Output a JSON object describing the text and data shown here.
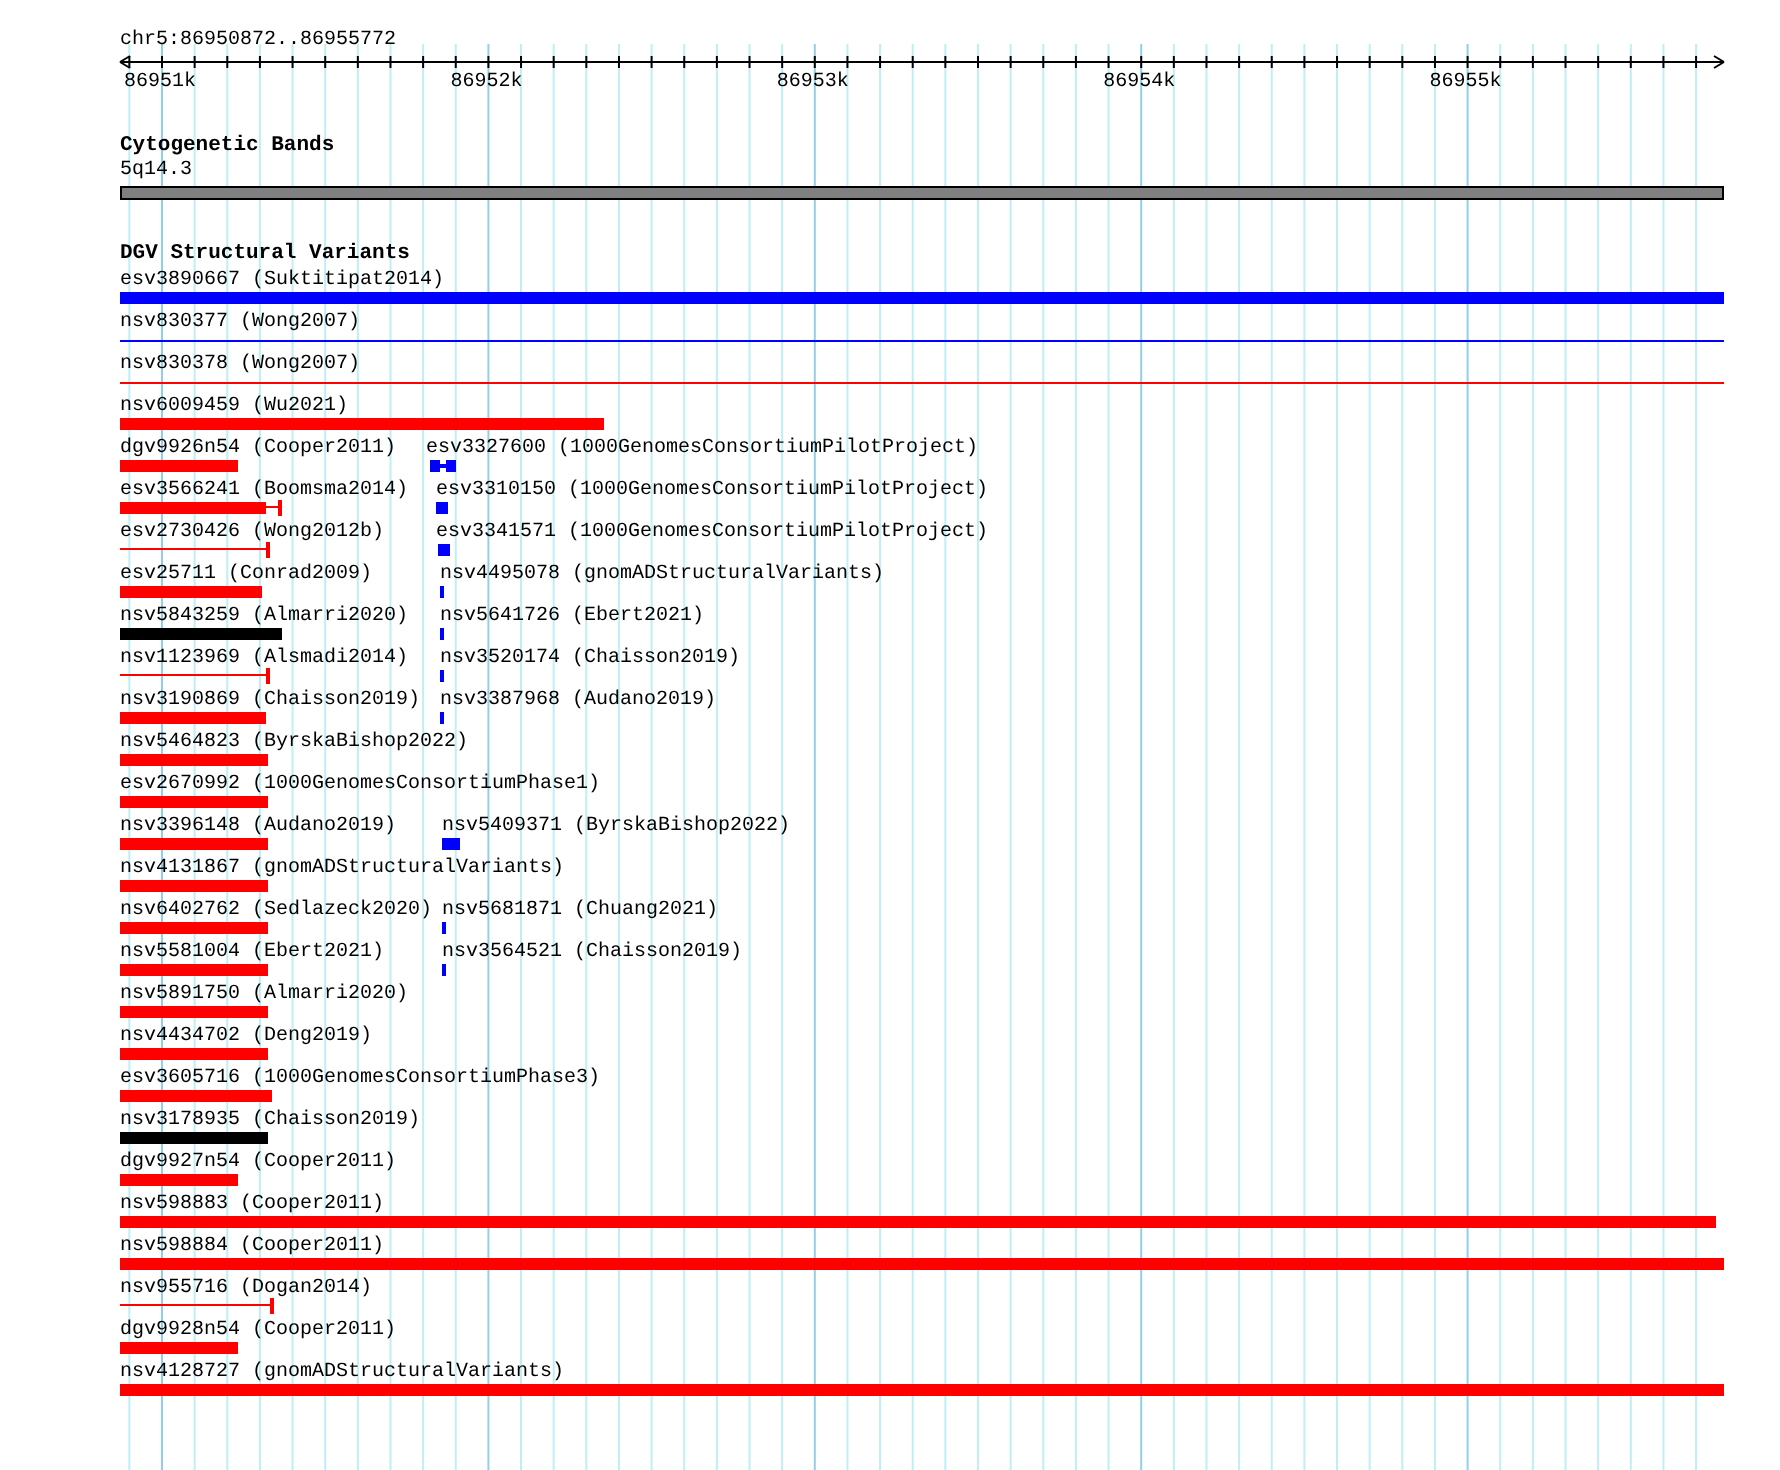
{
  "ruler": {
    "location": "chr5:86950872..86955772",
    "ticks": [
      "86951k",
      "86952k",
      "86953k",
      "86954k",
      "86955k"
    ]
  },
  "cytoband_track": {
    "title": "Cytogenetic Bands",
    "band": "5q14.3"
  },
  "dgv_track": {
    "title": "DGV Structural Variants",
    "rows": [
      {
        "features": [
          {
            "label": "esv3890667 (Suktitipat2014)",
            "color": "#0000ff",
            "kind": "thick"
          }
        ]
      },
      {
        "features": [
          {
            "label": "nsv830377 (Wong2007)",
            "color": "#0000ff",
            "kind": "thin"
          }
        ]
      },
      {
        "features": [
          {
            "label": "nsv830378 (Wong2007)",
            "color": "#ff0000",
            "kind": "thin"
          }
        ]
      },
      {
        "features": [
          {
            "label": "nsv6009459 (Wu2021)",
            "color": "#ff0000",
            "kind": "thick"
          }
        ]
      },
      {
        "features": [
          {
            "label": "dgv9926n54 (Cooper2011)",
            "color": "#ff0000",
            "kind": "thick"
          },
          {
            "label": "esv3327600 (1000GenomesConsortiumPilotProject)",
            "color": "#0000ff",
            "kind": "blocks"
          }
        ]
      },
      {
        "features": [
          {
            "label": "esv3566241 (Boomsma2014)",
            "color": "#ff0000",
            "kind": "thick_tail"
          },
          {
            "label": "esv3310150 (1000GenomesConsortiumPilotProject)",
            "color": "#0000ff",
            "kind": "thick"
          }
        ]
      },
      {
        "features": [
          {
            "label": "esv2730426 (Wong2012b)",
            "color": "#ff0000",
            "kind": "thin_tail"
          },
          {
            "label": "esv3341571 (1000GenomesConsortiumPilotProject)",
            "color": "#0000ff",
            "kind": "blocks"
          }
        ]
      },
      {
        "features": [
          {
            "label": "esv25711 (Conrad2009)",
            "color": "#ff0000",
            "kind": "thick"
          },
          {
            "label": "nsv4495078 (gnomADStructuralVariants)",
            "color": "#0000ff",
            "kind": "thick"
          }
        ]
      },
      {
        "features": [
          {
            "label": "nsv5843259 (Almarri2020)",
            "color": "#000000",
            "kind": "thick"
          },
          {
            "label": "nsv5641726 (Ebert2021)",
            "color": "#0000ff",
            "kind": "thick"
          }
        ]
      },
      {
        "features": [
          {
            "label": "nsv1123969 (Alsmadi2014)",
            "color": "#ff0000",
            "kind": "thin_tail"
          },
          {
            "label": "nsv3520174 (Chaisson2019)",
            "color": "#0000ff",
            "kind": "thick"
          }
        ]
      },
      {
        "features": [
          {
            "label": "nsv3190869 (Chaisson2019)",
            "color": "#ff0000",
            "kind": "thick"
          },
          {
            "label": "nsv3387968 (Audano2019)",
            "color": "#0000ff",
            "kind": "thick"
          }
        ]
      },
      {
        "features": [
          {
            "label": "nsv5464823 (ByrskaBishop2022)",
            "color": "#ff0000",
            "kind": "thick"
          }
        ]
      },
      {
        "features": [
          {
            "label": "esv2670992 (1000GenomesConsortiumPhase1)",
            "color": "#ff0000",
            "kind": "thick"
          }
        ]
      },
      {
        "features": [
          {
            "label": "nsv3396148 (Audano2019)",
            "color": "#ff0000",
            "kind": "thick"
          },
          {
            "label": "nsv5409371 (ByrskaBishop2022)",
            "color": "#0000ff",
            "kind": "thick"
          }
        ]
      },
      {
        "features": [
          {
            "label": "nsv4131867 (gnomADStructuralVariants)",
            "color": "#ff0000",
            "kind": "thick"
          }
        ]
      },
      {
        "features": [
          {
            "label": "nsv6402762 (Sedlazeck2020)",
            "color": "#ff0000",
            "kind": "thick"
          },
          {
            "label": "nsv5681871 (Chuang2021)",
            "color": "#0000ff",
            "kind": "thick"
          }
        ]
      },
      {
        "features": [
          {
            "label": "nsv5581004 (Ebert2021)",
            "color": "#ff0000",
            "kind": "thick"
          },
          {
            "label": "nsv3564521 (Chaisson2019)",
            "color": "#0000ff",
            "kind": "thick"
          }
        ]
      },
      {
        "features": [
          {
            "label": "nsv5891750 (Almarri2020)",
            "color": "#ff0000",
            "kind": "thick"
          }
        ]
      },
      {
        "features": [
          {
            "label": "nsv4434702 (Deng2019)",
            "color": "#ff0000",
            "kind": "thick"
          }
        ]
      },
      {
        "features": [
          {
            "label": "esv3605716 (1000GenomesConsortiumPhase3)",
            "color": "#ff0000",
            "kind": "thick"
          }
        ]
      },
      {
        "features": [
          {
            "label": "nsv3178935 (Chaisson2019)",
            "color": "#000000",
            "kind": "thick"
          }
        ]
      },
      {
        "features": [
          {
            "label": "dgv9927n54 (Cooper2011)",
            "color": "#ff0000",
            "kind": "thick"
          }
        ]
      },
      {
        "features": [
          {
            "label": "nsv598883 (Cooper2011)",
            "color": "#ff0000",
            "kind": "thick"
          }
        ]
      },
      {
        "features": [
          {
            "label": "nsv598884 (Cooper2011)",
            "color": "#ff0000",
            "kind": "thick"
          }
        ]
      },
      {
        "features": [
          {
            "label": "nsv955716 (Dogan2014)",
            "color": "#ff0000",
            "kind": "thin_tail"
          }
        ]
      },
      {
        "features": [
          {
            "label": "dgv9928n54 (Cooper2011)",
            "color": "#ff0000",
            "kind": "thick"
          }
        ]
      },
      {
        "features": [
          {
            "label": "nsv4128727 (gnomADStructuralVariants)",
            "color": "#ff0000",
            "kind": "thick"
          }
        ]
      }
    ]
  }
}
